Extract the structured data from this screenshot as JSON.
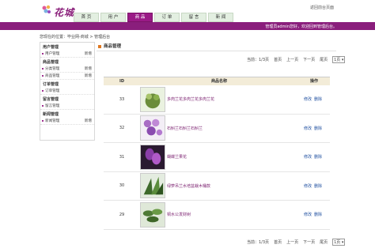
{
  "header": {
    "logo_text": "花城",
    "back_link": "返回前台页面",
    "welcome": "管理员admin您好，欢迎回到管理后台。"
  },
  "nav": {
    "tabs": [
      {
        "label": "首 页",
        "active": false
      },
      {
        "label": "用 户",
        "active": false
      },
      {
        "label": "商 品",
        "active": true
      },
      {
        "label": "订 单",
        "active": false
      },
      {
        "label": "留 言",
        "active": false
      },
      {
        "label": "新 闻",
        "active": false
      }
    ]
  },
  "breadcrumb": "您现在的位置：毕业网-商城 > 管理后台",
  "sidebar": {
    "groups": [
      {
        "title": "用户管理",
        "items": [
          {
            "label": "用户管理",
            "add": "新增"
          }
        ]
      },
      {
        "title": "商品管理",
        "items": [
          {
            "label": "分类管理",
            "add": "新增"
          },
          {
            "label": "商品管理",
            "add": "新增"
          }
        ]
      },
      {
        "title": "订单管理",
        "items": [
          {
            "label": "订单管理",
            "add": ""
          }
        ]
      },
      {
        "title": "留言管理",
        "items": [
          {
            "label": "留言管理",
            "add": ""
          }
        ]
      },
      {
        "title": "新闻管理",
        "items": [
          {
            "label": "新闻管理",
            "add": "新增"
          }
        ]
      }
    ]
  },
  "main": {
    "title": "商品管理",
    "pager": {
      "current": "当前：1/3页",
      "first": "首页",
      "prev": "上一页",
      "next": "下一页",
      "last": "尾页",
      "select_value": "1页"
    },
    "table": {
      "headers": {
        "id": "ID",
        "name": "商品名称",
        "op": "操作"
      },
      "rows": [
        {
          "id": "33",
          "name": "多肉兰花多肉兰花多肉兰花",
          "edit": "修改",
          "del": "删除",
          "thumb_color": "#6a8c3a"
        },
        {
          "id": "32",
          "name": "石斛兰石斛兰石斛兰",
          "edit": "修改",
          "del": "删除",
          "thumb_color": "#a86cc4"
        },
        {
          "id": "31",
          "name": "蝴蝶兰果花",
          "edit": "修改",
          "del": "删除",
          "thumb_color": "#8a3ea8"
        },
        {
          "id": "30",
          "name": "绿萝吊兰水培盆栽木桶款",
          "edit": "修改",
          "del": "删除",
          "thumb_color": "#3e6a2c"
        },
        {
          "id": "29",
          "name": "铜水公发财树",
          "edit": "修改",
          "del": "删除",
          "thumb_color": "#4f7a36"
        }
      ]
    }
  },
  "colors": {
    "brand_purple": "#8a1e7c",
    "nav_bg": "#e3efe1",
    "table_head": "#f3ecd8",
    "link_blue": "#1f4fa0"
  }
}
